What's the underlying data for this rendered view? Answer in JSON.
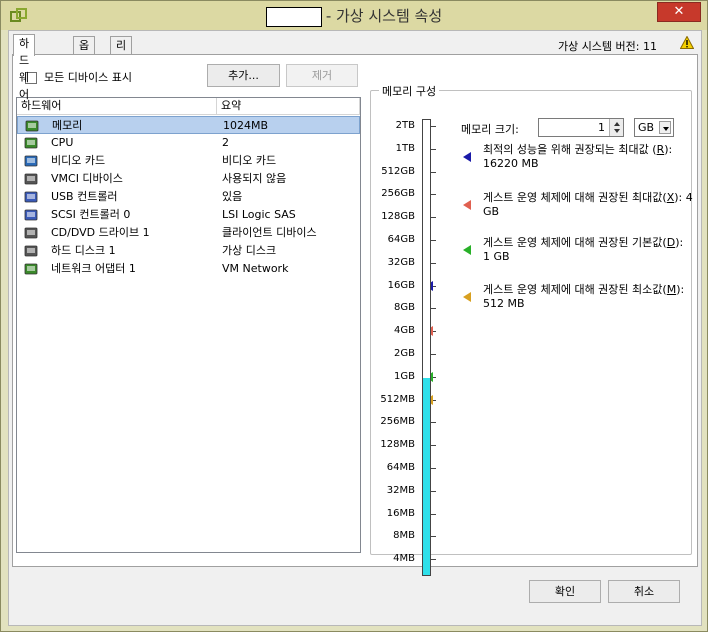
{
  "window": {
    "title": "- 가상 시스템 속성",
    "close_label": "✕",
    "icon": "vm-properties-icon"
  },
  "tabs": [
    {
      "label": "하드웨어",
      "active": true
    },
    {
      "label": "옵션",
      "active": false
    },
    {
      "label": "리소스",
      "active": false
    }
  ],
  "version": {
    "label": "가상 시스템 버전: 11",
    "warning_icon": "warning-icon"
  },
  "hardware": {
    "show_all_label": "모든 디바이스 표시",
    "add_label": "추가...",
    "remove_label": "제거",
    "columns": [
      "하드웨어",
      "요약"
    ],
    "rows": [
      {
        "name": "메모리",
        "summary": "1024MB",
        "icon": "memory-icon",
        "color": "#3a8a2a",
        "selected": true
      },
      {
        "name": "CPU",
        "summary": "2",
        "icon": "cpu-icon",
        "color": "#3a8a2a"
      },
      {
        "name": "비디오 카드",
        "summary": "비디오 카드",
        "icon": "monitor-icon",
        "color": "#2a6ab8"
      },
      {
        "name": "VMCI 디바이스",
        "summary": "사용되지 않음",
        "icon": "vmci-icon",
        "color": "#555555"
      },
      {
        "name": "USB 컨트롤러",
        "summary": "있음",
        "icon": "usb-icon",
        "color": "#3a5ab8"
      },
      {
        "name": "SCSI 컨트롤러 0",
        "summary": "LSI Logic SAS",
        "icon": "scsi-icon",
        "color": "#3a5ab8"
      },
      {
        "name": "CD/DVD 드라이브 1",
        "summary": "클라이언트 디바이스",
        "icon": "cd-dvd-icon",
        "color": "#555555"
      },
      {
        "name": "하드 디스크 1",
        "summary": "가상 디스크",
        "icon": "hard-disk-icon",
        "color": "#555555"
      },
      {
        "name": "네트워크 어댑터 1",
        "summary": "VM Network",
        "icon": "network-adapter-icon",
        "color": "#3a8a2a"
      }
    ]
  },
  "memory": {
    "section_title": "메모리 구성",
    "size_label": "메모리 크기:",
    "size_value": "1",
    "unit": "GB",
    "scale": [
      "2TB",
      "1TB",
      "512GB",
      "256GB",
      "128GB",
      "64GB",
      "32GB",
      "16GB",
      "8GB",
      "4GB",
      "2GB",
      "1GB",
      "512MB",
      "256MB",
      "128MB",
      "64MB",
      "32MB",
      "16MB",
      "8MB",
      "4MB"
    ],
    "current_level": "1GB",
    "fill_color": "#2fe0ea",
    "recommendations": [
      {
        "text_before": "최적의 성능을 위해 권장되는 최대값 (",
        "key": "R",
        "text_after": "): 16220 MB",
        "color": "#1a1aa8",
        "level": "16GB"
      },
      {
        "text_before": "게스트 운영 체제에 대해 권장된 최대값(",
        "key": "X",
        "text_after": "): 4 GB",
        "color": "#e06050",
        "level": "4GB"
      },
      {
        "text_before": "게스트 운영 체제에 대해 권장된 기본값(",
        "key": "D",
        "text_after": "): 1 GB",
        "color": "#28b028",
        "level": "1GB"
      },
      {
        "text_before": "게스트 운영 체제에 대해 권장된 최소값(",
        "key": "M",
        "text_after": "): 512 MB",
        "color": "#d8a020",
        "level": "512MB"
      }
    ]
  },
  "dialog": {
    "ok_label": "확인",
    "cancel_label": "취소"
  }
}
